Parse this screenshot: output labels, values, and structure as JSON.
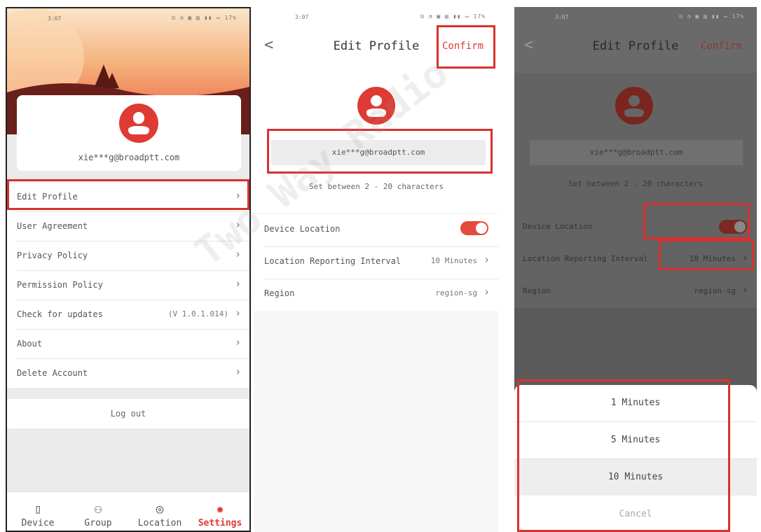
{
  "colors": {
    "accent": "#e03a34",
    "highlight_frame": "#d9312f"
  },
  "status_bar": {
    "time": "3:07",
    "icons": "⊡ ◔ ▣ ▤ ▮▮ ▭ 17%"
  },
  "settings": {
    "email": "xie***g@broadptt.com",
    "menu": [
      {
        "label": "Edit Profile",
        "value": ""
      },
      {
        "label": "User Agreement",
        "value": ""
      },
      {
        "label": "Privacy Policy",
        "value": ""
      },
      {
        "label": "Permission Policy",
        "value": ""
      },
      {
        "label": "Check for updates",
        "value": "(V 1.0.1.014)"
      },
      {
        "label": "About",
        "value": ""
      },
      {
        "label": "Delete Account",
        "value": ""
      }
    ],
    "logout_label": "Log out",
    "tabs": [
      {
        "label": "Device",
        "icon": "walkie-talkie-icon"
      },
      {
        "label": "Group",
        "icon": "group-icon"
      },
      {
        "label": "Location",
        "icon": "location-pin-icon"
      },
      {
        "label": "Settings",
        "icon": "gear-icon"
      }
    ]
  },
  "edit_profile": {
    "title": "Edit Profile",
    "back_label": "<",
    "confirm_label": "Confirm",
    "email": "xie***g@broadptt.com",
    "hint": "Set between 2 - 20 characters",
    "device_location_label": "Device Location",
    "device_location_enabled": true,
    "interval_label": "Location Reporting Interval",
    "interval_value": "10 Minutes",
    "region_label": "Region",
    "region_value": "region-sg"
  },
  "interval_picker": {
    "options": [
      "1 Minutes",
      "5 Minutes",
      "10 Minutes"
    ],
    "selected": "10 Minutes",
    "cancel_label": "Cancel"
  },
  "watermark": {
    "line1": "Two Way Radio"
  }
}
